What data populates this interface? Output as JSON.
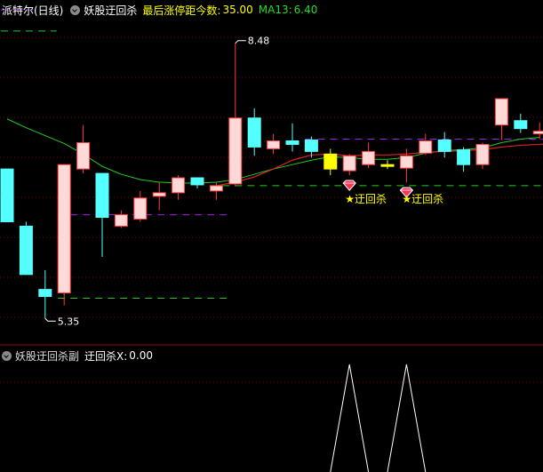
{
  "header": {
    "stock_name": "派特尔(日线)",
    "indicator_name": "妖股迂回杀",
    "stat_label": "最后涨停距今数:",
    "stat_value": "35.00",
    "ma_label": "MA13:",
    "ma_value": "6.40"
  },
  "sub_header": {
    "indicator_name": "妖股迂回杀副",
    "value_label": "迂回杀X:",
    "value": "0.00"
  },
  "colors": {
    "up": "#ff3c3c",
    "up_fill": "#ffd8d8",
    "down": "#54ffff",
    "ma": "#22cc22",
    "line_red": "#dd2222",
    "signal_dashed": "#22cc22",
    "purple": "#a020f0",
    "signal_text": "#ffff00"
  },
  "chart_data": {
    "type": "candlestick",
    "y_domain": [
      5.1,
      8.75
    ],
    "high_label": "8.48",
    "low_label": "5.35",
    "candles": [
      {
        "o": 7.05,
        "h": 7.05,
        "c": 6.45,
        "l": 6.45
      },
      {
        "o": 6.4,
        "h": 6.45,
        "c": 5.85,
        "l": 5.85
      },
      {
        "o": 5.68,
        "h": 5.9,
        "c": 5.6,
        "l": 5.35
      },
      {
        "o": 5.64,
        "h": 7.1,
        "c": 7.1,
        "l": 5.5
      },
      {
        "o": 7.05,
        "h": 7.55,
        "c": 7.35,
        "l": 7.0
      },
      {
        "o": 7.0,
        "h": 7.0,
        "c": 6.5,
        "l": 6.05
      },
      {
        "o": 6.4,
        "h": 6.58,
        "c": 6.53,
        "l": 6.38
      },
      {
        "o": 6.48,
        "h": 6.8,
        "c": 6.72,
        "l": 6.45
      },
      {
        "o": 6.74,
        "h": 6.9,
        "c": 6.78,
        "l": 6.58
      },
      {
        "o": 6.78,
        "h": 6.98,
        "c": 6.95,
        "l": 6.7
      },
      {
        "o": 6.95,
        "h": 6.95,
        "c": 6.87,
        "l": 6.83
      },
      {
        "o": 6.8,
        "h": 6.9,
        "c": 6.86,
        "l": 6.7
      },
      {
        "o": 6.88,
        "h": 8.48,
        "c": 7.63,
        "l": 6.85
      },
      {
        "o": 7.63,
        "h": 7.74,
        "c": 7.3,
        "l": 7.2
      },
      {
        "o": 7.28,
        "h": 7.45,
        "c": 7.37,
        "l": 7.22
      },
      {
        "o": 7.37,
        "h": 7.57,
        "c": 7.33,
        "l": 7.25
      },
      {
        "o": 7.38,
        "h": 7.42,
        "c": 7.25,
        "l": 7.18
      },
      {
        "o": 7.22,
        "h": 7.28,
        "c": 7.05,
        "l": 6.98
      },
      {
        "o": 7.03,
        "h": 7.22,
        "c": 7.2,
        "l": 6.98
      },
      {
        "o": 7.1,
        "h": 7.35,
        "c": 7.25,
        "l": 7.06
      },
      {
        "o": 7.1,
        "h": 7.15,
        "c": 7.08,
        "l": 7.05
      },
      {
        "o": 7.06,
        "h": 7.28,
        "c": 7.2,
        "l": 6.9
      },
      {
        "o": 7.23,
        "h": 7.45,
        "c": 7.37,
        "l": 7.21
      },
      {
        "o": 7.38,
        "h": 7.47,
        "c": 7.25,
        "l": 7.18
      },
      {
        "o": 7.27,
        "h": 7.3,
        "c": 7.1,
        "l": 7.02
      },
      {
        "o": 7.1,
        "h": 7.35,
        "c": 7.33,
        "l": 7.05
      },
      {
        "o": 7.55,
        "h": 7.7,
        "c": 7.85,
        "l": 7.38
      },
      {
        "o": 7.6,
        "h": 7.68,
        "c": 7.51,
        "l": 7.46
      },
      {
        "o": 7.45,
        "h": 7.58,
        "c": 7.48,
        "l": 7.39
      }
    ],
    "ma_line": [
      7.62,
      7.52,
      7.43,
      7.34,
      7.22,
      7.08,
      6.99,
      6.93,
      6.9,
      6.89,
      6.89,
      6.9,
      6.93,
      6.99,
      7.05,
      7.1,
      7.15,
      7.19,
      7.18,
      7.16,
      7.16,
      7.18,
      7.23,
      7.26,
      7.27,
      7.29,
      7.35,
      7.39,
      7.41
    ],
    "red_line": {
      "start_index": 11,
      "values": [
        6.86,
        6.9,
        6.96,
        7.05,
        7.15,
        7.21,
        7.22,
        7.2,
        7.21,
        7.21,
        7.22,
        7.24,
        7.25,
        7.26,
        7.27,
        7.3,
        7.32,
        7.33,
        7.35
      ]
    },
    "dashed_levels": [
      {
        "color": "green",
        "value": 8.62,
        "from": 0,
        "to": 2
      },
      {
        "color": "purple",
        "value": 8.86,
        "from": 0,
        "to": 1
      },
      {
        "color": "purple",
        "value": 6.53,
        "from": 3,
        "to": 11
      },
      {
        "color": "green",
        "value": 5.58,
        "from": 3,
        "to": 11
      },
      {
        "color": "green",
        "value": 6.86,
        "from": 11,
        "to": 28
      },
      {
        "color": "purple",
        "value": 7.39,
        "from": 16,
        "to": 28
      }
    ],
    "highlight_candles": [
      17,
      20
    ],
    "signals": [
      {
        "index": 18,
        "label": "★迂回杀"
      },
      {
        "index": 21,
        "label": "★迂回杀"
      }
    ],
    "sub_chart": {
      "type": "line",
      "values": [
        0,
        0,
        0,
        0,
        0,
        0,
        0,
        0,
        0,
        0,
        0,
        0,
        0,
        0,
        0,
        0,
        0,
        0,
        1,
        0,
        0,
        1,
        0,
        0,
        0,
        0,
        0,
        0,
        0
      ],
      "ylim": [
        0,
        1
      ]
    }
  }
}
